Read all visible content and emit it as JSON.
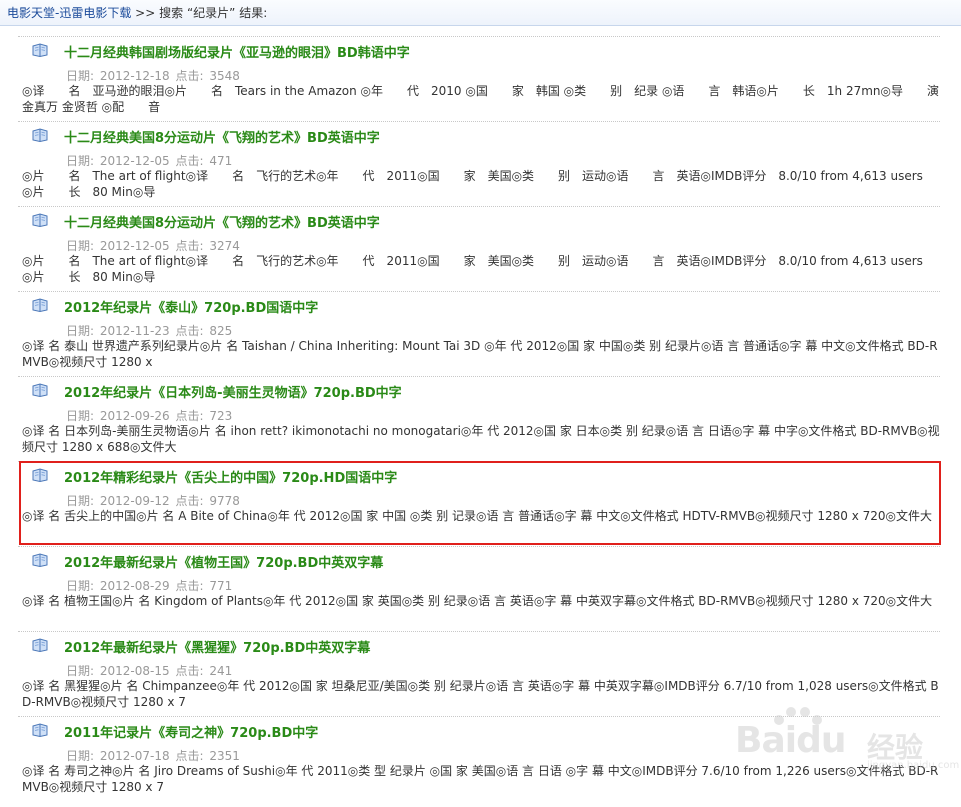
{
  "breadcrumb": {
    "home": "电影天堂-迅雷电影下载",
    "separator": ">>",
    "search_prefix": "搜索",
    "search_term": "“纪录片”",
    "search_suffix": "结果:"
  },
  "results": [
    {
      "title": "十二月经典韩国剧场版纪录片《亚马逊的眼泪》BD韩语中字",
      "date_label": "日期:",
      "date": "2012-12-18",
      "clicks_label": "点击:",
      "clicks": "3548",
      "desc": "◎译　　名　亚马逊的眼泪◎片　　名　Tears in the Amazon ◎年　　代　2010 ◎国　　家　韩国 ◎类　　别　纪录 ◎语　　言　韩语◎片　　长　1h 27mn◎导　　演　金真万 金贤哲 ◎配　　音"
    },
    {
      "title": "十二月经典美国8分运动片《飞翔的艺术》BD英语中字",
      "date_label": "日期:",
      "date": "2012-12-05",
      "clicks_label": "点击:",
      "clicks": "471",
      "desc": "◎片　　名　The art of flight◎译　　名　飞行的艺术◎年　　代　2011◎国　　家　美国◎类　　别　运动◎语　　言　英语◎IMDB评分　8.0/10 from 4,613 users　◎片　　长　80 Min◎导"
    },
    {
      "title": "十二月经典美国8分运动片《飞翔的艺术》BD英语中字",
      "date_label": "日期:",
      "date": "2012-12-05",
      "clicks_label": "点击:",
      "clicks": "3274",
      "desc": "◎片　　名　The art of flight◎译　　名　飞行的艺术◎年　　代　2011◎国　　家　美国◎类　　别　运动◎语　　言　英语◎IMDB评分　8.0/10 from 4,613 users　◎片　　长　80 Min◎导"
    },
    {
      "title": "2012年纪录片《泰山》720p.BD国语中字",
      "date_label": "日期:",
      "date": "2012-11-23",
      "clicks_label": "点击:",
      "clicks": "825",
      "desc": "◎译 名 泰山 世界遗产系列纪录片◎片 名 Taishan / China Inheriting: Mount Tai 3D ◎年 代 2012◎国 家 中国◎类 别 纪录片◎语 言 普通话◎字 幕 中文◎文件格式 BD-RMVB◎视频尺寸 1280 x"
    },
    {
      "title": "2012年纪录片《日本列岛-美丽生灵物语》720p.BD中字",
      "date_label": "日期:",
      "date": "2012-09-26",
      "clicks_label": "点击:",
      "clicks": "723",
      "desc": "◎译 名 日本列岛-美丽生灵物语◎片 名 ihon rett? ikimonotachi no monogatari◎年 代 2012◎国 家 日本◎类 别 纪录◎语 言 日语◎字 幕 中字◎文件格式 BD-RMVB◎视频尺寸 1280 x 688◎文件大"
    },
    {
      "title": "2012年精彩纪录片《舌尖上的中国》720p.HD国语中字",
      "date_label": "日期:",
      "date": "2012-09-12",
      "clicks_label": "点击:",
      "clicks": "9778",
      "desc": "◎译 名 舌尖上的中国◎片 名 A Bite of China◎年 代 2012◎国 家 中国 ◎类 别 记录◎语 言 普通话◎字 幕 中文◎文件格式 HDTV-RMVB◎视频尺寸 1280 x 720◎文件大"
    },
    {
      "title": "2012年最新纪录片《植物王国》720p.BD中英双字幕",
      "date_label": "日期:",
      "date": "2012-08-29",
      "clicks_label": "点击:",
      "clicks": "771",
      "desc": "◎译 名 植物王国◎片 名 Kingdom of Plants◎年 代 2012◎国 家 英国◎类 别 纪录◎语 言 英语◎字 幕 中英双字幕◎文件格式 BD-RMVB◎视频尺寸 1280 x 720◎文件大"
    },
    {
      "title": "2012年最新纪录片《黑猩猩》720p.BD中英双字幕",
      "date_label": "日期:",
      "date": "2012-08-15",
      "clicks_label": "点击:",
      "clicks": "241",
      "desc": "◎译 名 黑猩猩◎片 名 Chimpanzee◎年 代 2012◎国 家 坦桑尼亚/美国◎类 别 纪录片◎语 言 英语◎字 幕 中英双字幕◎IMDB评分 6.7/10 from 1,028 users◎文件格式 BD-RMVB◎视频尺寸 1280 x 7"
    },
    {
      "title": "2011年记录片《寿司之神》720p.BD中字",
      "date_label": "日期:",
      "date": "2012-07-18",
      "clicks_label": "点击:",
      "clicks": "2351",
      "desc": "◎译 名 寿司之神◎片 名 Jiro Dreams of Sushi◎年 代 2011◎类 型 纪录片 ◎国 家 美国◎语 言 日语 ◎字 幕 中文◎IMDB评分 7.6/10 from 1,226 users◎文件格式 BD-RMVB◎视频尺寸 1280 x 7"
    }
  ],
  "watermark": {
    "text": "Baidu",
    "cn": "经验",
    "sub": "jingyan.baidu.com"
  },
  "icons": {
    "result": "book-icon"
  },
  "colors": {
    "title": "#2a8a17",
    "link": "#1a4a9a",
    "meta": "#999999",
    "highlight": "#e0201c"
  }
}
